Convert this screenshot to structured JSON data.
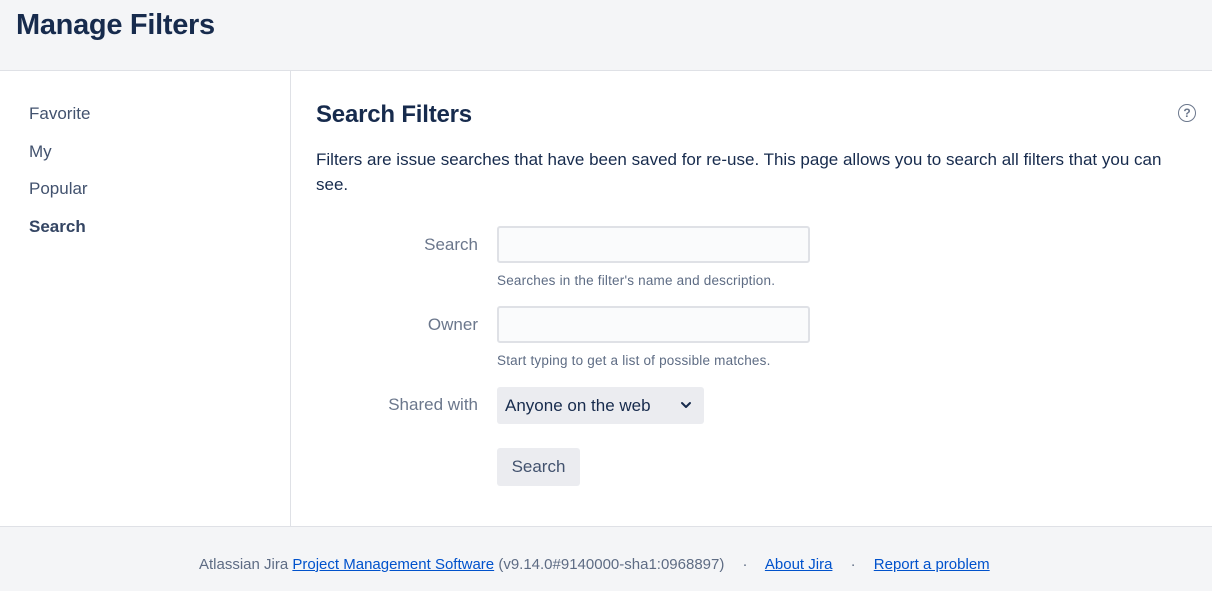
{
  "header": {
    "title": "Manage Filters"
  },
  "sidebar": {
    "items": [
      {
        "label": "Favorite"
      },
      {
        "label": "My"
      },
      {
        "label": "Popular"
      },
      {
        "label": "Search"
      }
    ]
  },
  "main": {
    "title": "Search Filters",
    "help_icon": "question-circle-icon",
    "description": "Filters are issue searches that have been saved for re-use. This page allows you to search all filters that you can see.",
    "form": {
      "search_label": "Search",
      "search_value": "",
      "search_hint": "Searches in the filter's name and description.",
      "owner_label": "Owner",
      "owner_value": "",
      "owner_hint": "Start typing to get a list of possible matches.",
      "shared_label": "Shared with",
      "shared_value": "Anyone on the web",
      "search_button": "Search"
    }
  },
  "footer": {
    "prefix": "Atlassian Jira",
    "link_software": "Project Management Software",
    "version": "(v9.14.0#9140000-sha1:0968897)",
    "separator": "·",
    "link_about": "About Jira",
    "link_report": "Report a problem"
  }
}
